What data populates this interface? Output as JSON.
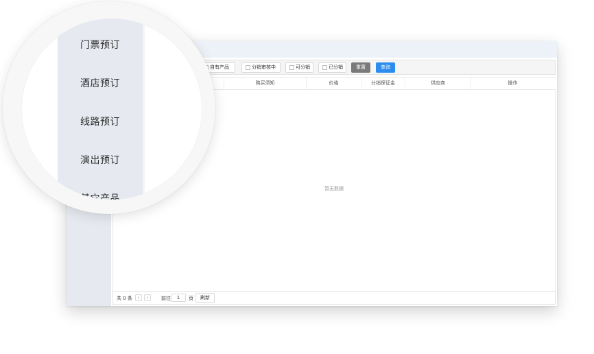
{
  "filters": [
    {
      "label": "自有产品"
    },
    {
      "label": "分销审核中"
    },
    {
      "label": "可分销"
    },
    {
      "label": "已分销"
    }
  ],
  "actions": {
    "reset_label": "重置",
    "query_label": "查询",
    "reset_color": "#7a7a7a",
    "query_color": "#2d8cf0"
  },
  "table": {
    "columns": [
      "购买须知",
      "价格",
      "分销保证金",
      "供应商",
      "操作"
    ],
    "empty_text": "暂无数据"
  },
  "pager": {
    "total_text": "共 0 条",
    "prev_icon": "‹",
    "next_icon": "›",
    "goto_label": "前往",
    "current_page": "1",
    "page_unit": "页",
    "refresh_label": "刷新"
  },
  "magnifier_menu": [
    {
      "label": "门票预订"
    },
    {
      "label": "酒店预订"
    },
    {
      "label": "线路预订"
    },
    {
      "label": "演出预订"
    },
    {
      "label": "其它产品"
    }
  ]
}
